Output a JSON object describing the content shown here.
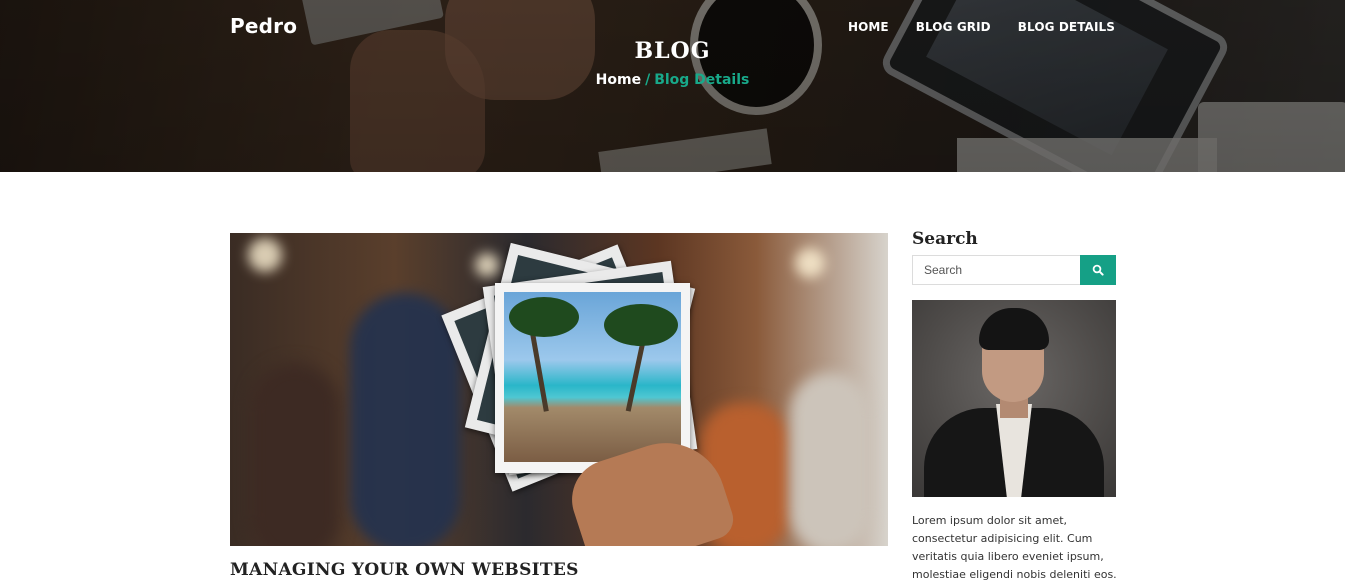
{
  "header": {
    "logo": "Pedro",
    "nav": [
      {
        "label": "HOME"
      },
      {
        "label": "BLOG GRID"
      },
      {
        "label": "BLOG DETAILS"
      }
    ],
    "title": "BLOG",
    "breadcrumb": {
      "home": "Home",
      "separator": "/",
      "current": "Blog Details"
    }
  },
  "post": {
    "title": "MANAGING YOUR OWN WEBSITES"
  },
  "sidebar": {
    "search_heading": "Search",
    "search_placeholder": "Search",
    "search_icon": "search-icon",
    "bio_text": "Lorem ipsum dolor sit amet, consectetur adipisicing elit. Cum veritatis quia libero eveniet ipsum, molestiae eligendi nobis deleniti eos."
  },
  "colors": {
    "accent": "#15a086",
    "breadcrumb_active": "#18a98a"
  }
}
